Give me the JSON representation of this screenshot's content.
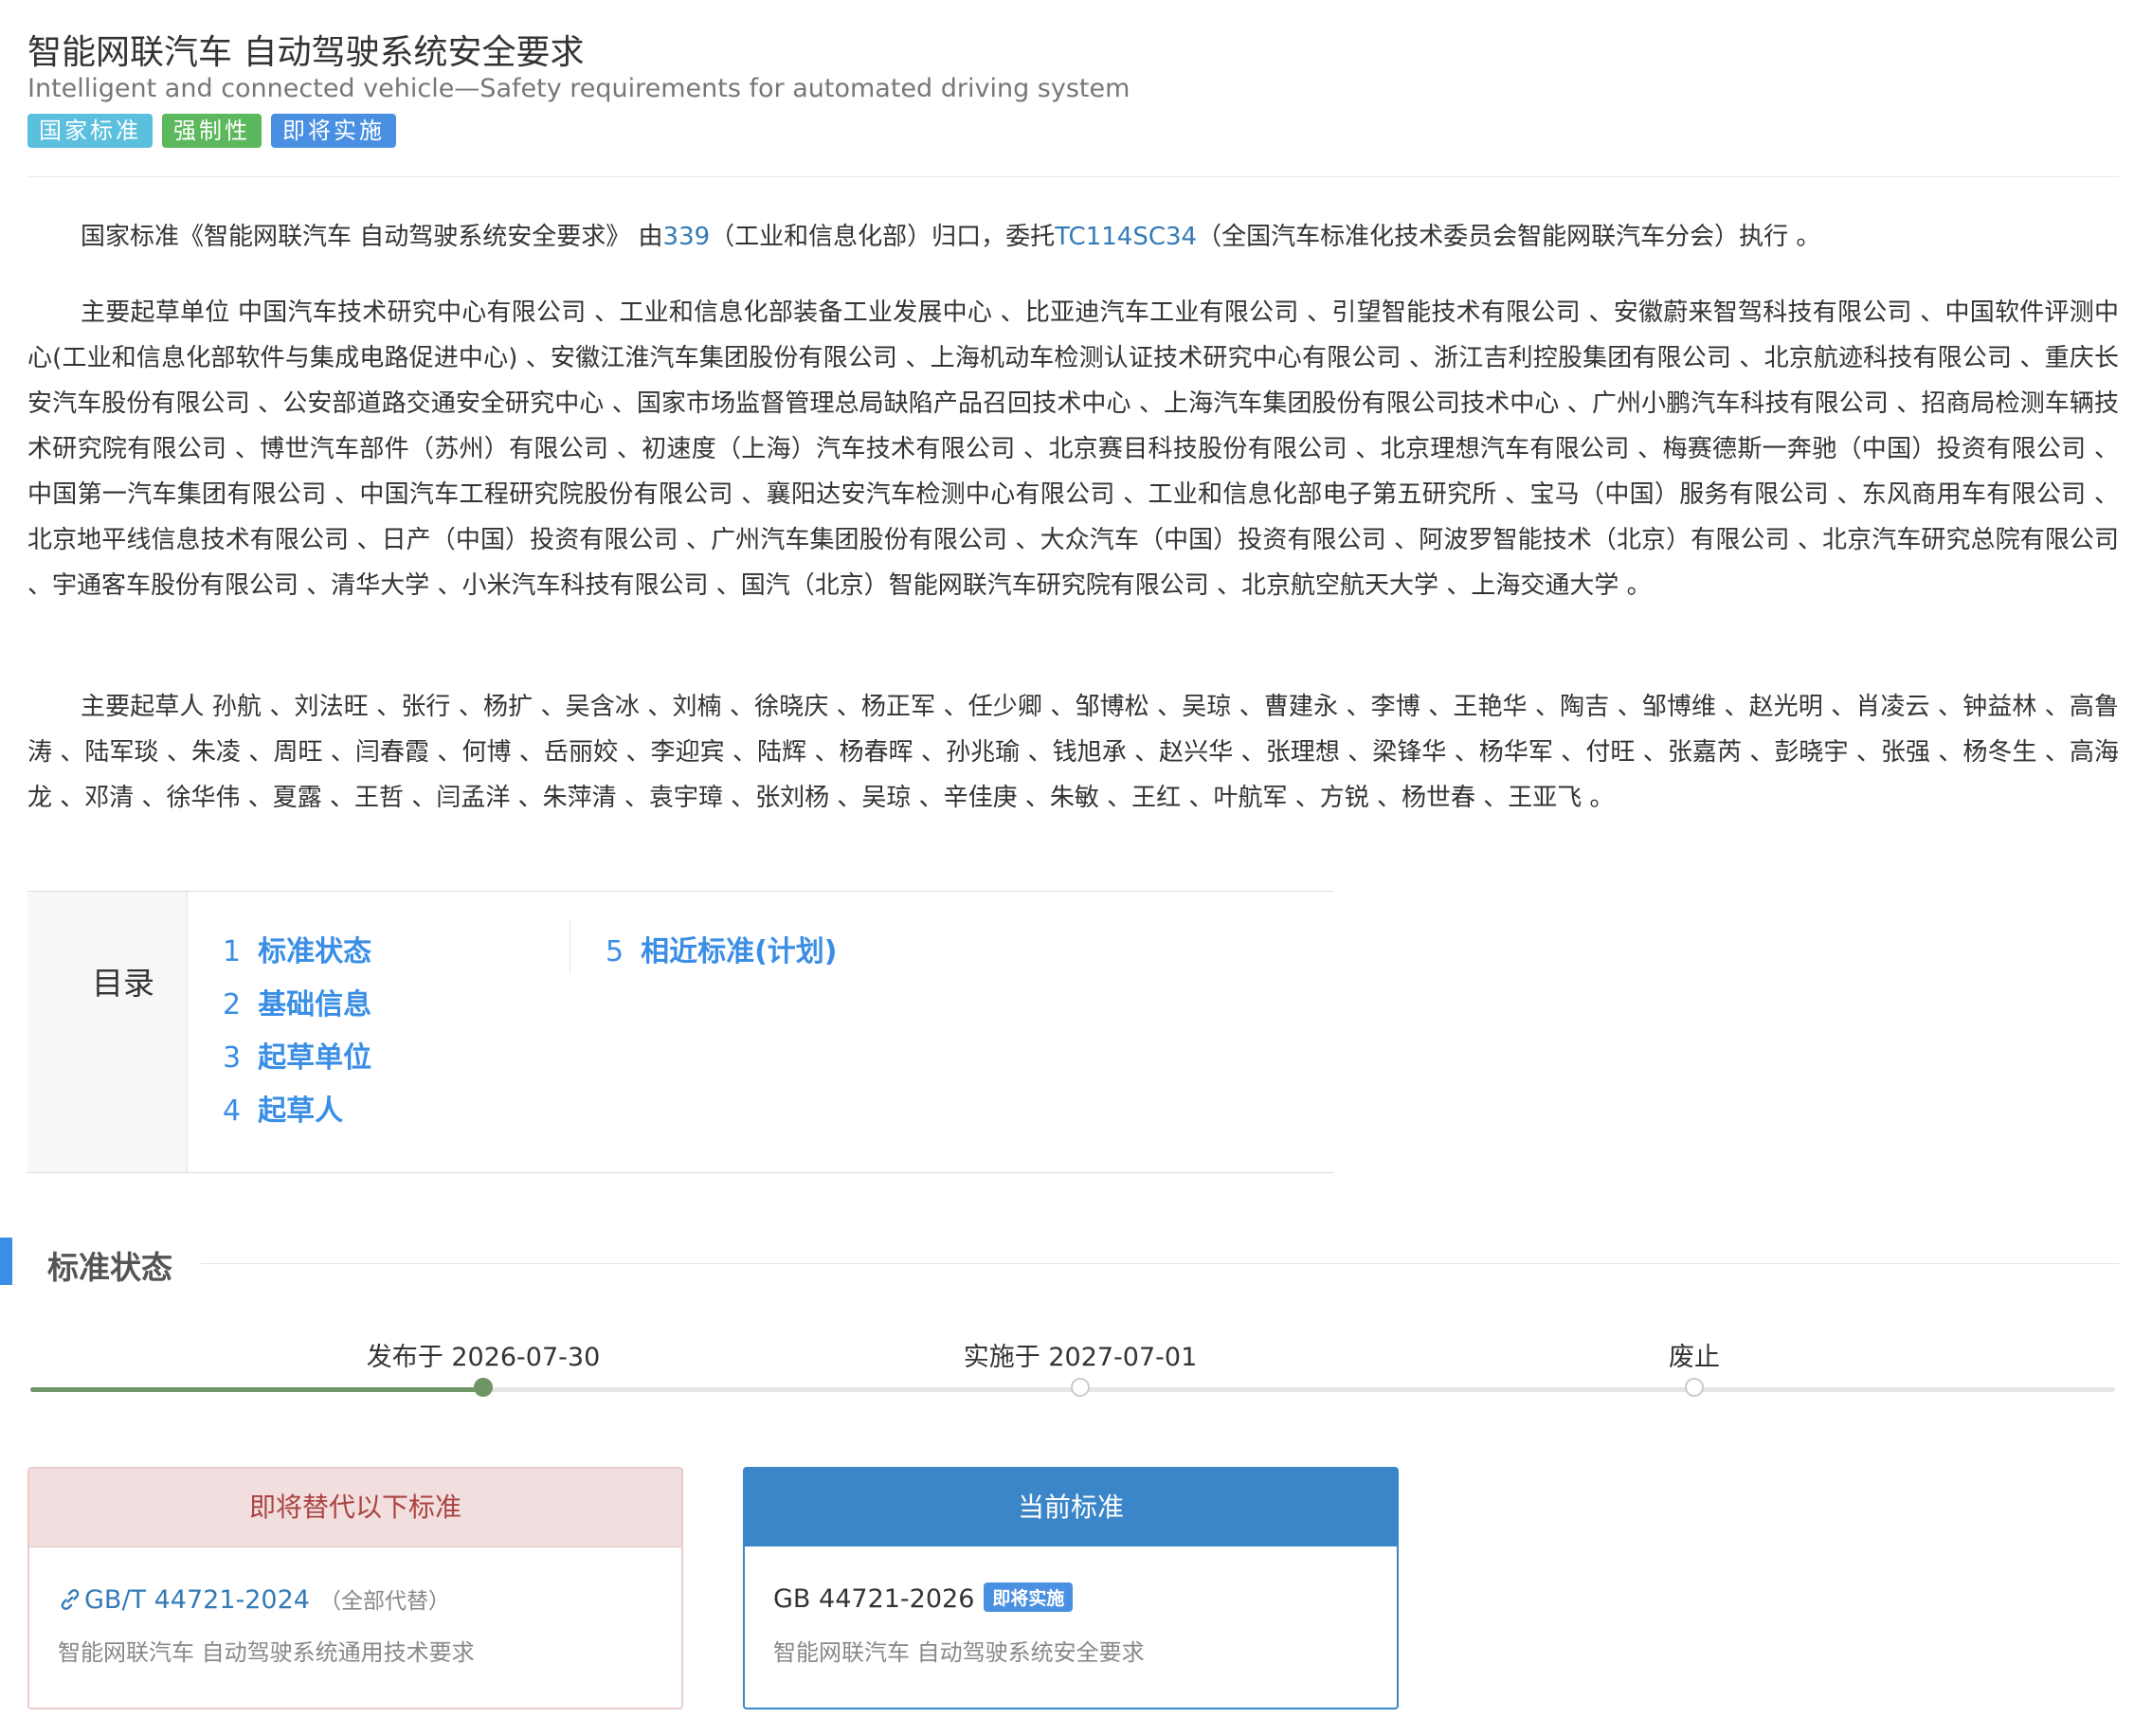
{
  "header": {
    "title": "智能网联汽车 自动驾驶系统安全要求",
    "subtitle": "Intelligent and connected vehicle—Safety requirements for automated driving system",
    "badges": [
      "国家标准",
      "强制性",
      "即将实施"
    ]
  },
  "intro": {
    "p1_prefix": "国家标准《智能网联汽车 自动驾驶系统安全要求》 由",
    "committee_link": "339",
    "p1_mid": "（工业和信息化部）归口，委托",
    "tc_link": "TC114SC34",
    "p1_suffix": "（全国汽车标准化技术委员会智能网联汽车分会）执行 。",
    "p2": "主要起草单位 中国汽车技术研究中心有限公司 、工业和信息化部装备工业发展中心 、比亚迪汽车工业有限公司 、引望智能技术有限公司 、安徽蔚来智驾科技有限公司 、中国软件评测中心(工业和信息化部软件与集成电路促进中心) 、安徽江淮汽车集团股份有限公司 、上海机动车检测认证技术研究中心有限公司 、浙江吉利控股集团有限公司 、北京航迹科技有限公司 、重庆长安汽车股份有限公司 、公安部道路交通安全研究中心 、国家市场监督管理总局缺陷产品召回技术中心 、上海汽车集团股份有限公司技术中心 、广州小鹏汽车科技有限公司 、招商局检测车辆技术研究院有限公司 、博世汽车部件（苏州）有限公司 、初速度（上海）汽车技术有限公司 、北京赛目科技股份有限公司 、北京理想汽车有限公司 、梅赛德斯一奔驰（中国）投资有限公司 、中国第一汽车集团有限公司 、中国汽车工程研究院股份有限公司 、襄阳达安汽车检测中心有限公司 、工业和信息化部电子第五研究所 、宝马（中国）服务有限公司 、东风商用车有限公司 、北京地平线信息技术有限公司 、日产（中国）投资有限公司 、广州汽车集团股份有限公司 、大众汽车（中国）投资有限公司 、阿波罗智能技术（北京）有限公司 、北京汽车研究总院有限公司 、宇通客车股份有限公司 、清华大学 、小米汽车科技有限公司 、国汽（北京）智能网联汽车研究院有限公司 、北京航空航天大学 、上海交通大学 。",
    "p3": "主要起草人 孙航 、刘法旺 、张行 、杨扩 、吴含冰 、刘楠 、徐晓庆 、杨正军 、任少卿 、邹博松 、吴琼 、曹建永 、李博 、王艳华 、陶吉 、邹博维 、赵光明 、肖凌云 、钟益林 、高鲁涛 、陆军琰 、朱凌 、周旺 、闫春霞 、何博 、岳丽姣 、李迎宾 、陆辉 、杨春晖 、孙兆瑜 、钱旭承 、赵兴华 、张理想 、梁锋华 、杨华军 、付旺 、张嘉芮 、彭晓宇 、张强 、杨冬生 、高海龙 、邓清 、徐华伟 、夏露 、王哲 、闫孟洋 、朱萍清 、袁宇璋 、张刘杨 、吴琼 、辛佳庚 、朱敏 、王红 、叶航军 、方锐 、杨世春 、王亚飞 。"
  },
  "toc": {
    "label": "目录",
    "items": [
      {
        "num": "1",
        "label": "标准状态"
      },
      {
        "num": "2",
        "label": "基础信息"
      },
      {
        "num": "3",
        "label": "起草单位"
      },
      {
        "num": "4",
        "label": "起草人"
      },
      {
        "num": "5",
        "label": "相近标准(计划)"
      }
    ]
  },
  "status_section": {
    "title": "标准状态",
    "timeline": [
      {
        "label": "发布于 2026-07-30",
        "reached": true
      },
      {
        "label": "实施于 2027-07-01",
        "reached": false
      },
      {
        "label": "废止",
        "reached": false
      }
    ]
  },
  "replace_card": {
    "header": "即将替代以下标准",
    "code": "GB/T 44721-2024",
    "note": "（全部代替）",
    "name": "智能网联汽车 自动驾驶系统通用技术要求"
  },
  "current_card": {
    "header": "当前标准",
    "code": "GB 44721-2026",
    "badge": "即将实施",
    "name": "智能网联汽车 自动驾驶系统安全要求"
  },
  "colors": {
    "accent": "#3a8ee6",
    "badge_teal": "#5bc0de",
    "badge_green": "#5cb85c",
    "badge_blue": "#4a90e2",
    "timeline_done": "#6f9567",
    "replace_header_bg": "#f2dede",
    "current_header_bg": "#3a86c8"
  },
  "icons": {
    "replace_link": "link-icon"
  }
}
